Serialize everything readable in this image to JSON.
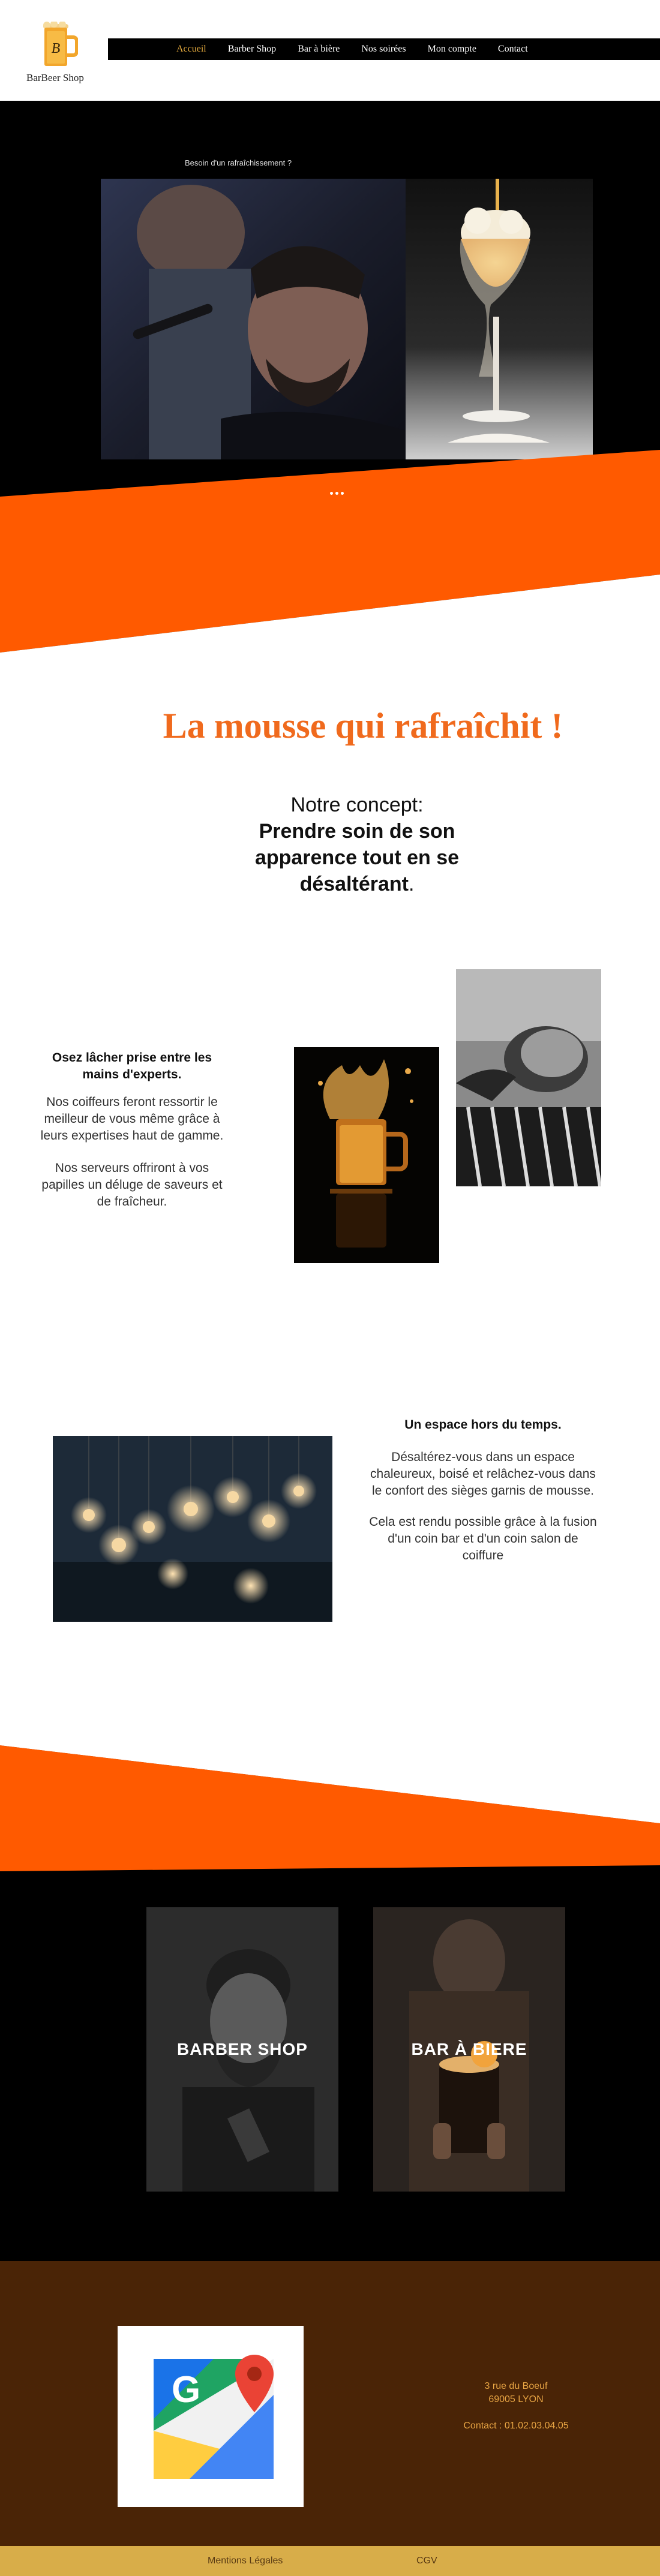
{
  "header": {
    "brand": "BarBeer Shop",
    "nav": [
      "Accueil",
      "Barber Shop",
      "Bar à bière",
      "Nos soirées",
      "Mon compte",
      "Contact"
    ],
    "active_index": 0
  },
  "hero": {
    "tagline": "Besoin d'un rafraîchissement ?",
    "image_left": "barber-trimming-client-photo",
    "image_right": "beer-glass-foam-photo",
    "slider_dots": 3
  },
  "intro": {
    "title": "La mousse qui rafraîchit !",
    "concept_lead": "Notre concept:",
    "concept_bold": "Prendre soin de son apparence tout en se désaltérant",
    "concept_tail": "."
  },
  "section_experts": {
    "heading": "Osez lâcher prise entre les mains d'experts.",
    "paragraph_1": "Nos coiffeurs feront ressortir le meilleur de vous même grâce à leurs expertises haut de gamme.",
    "paragraph_2": "Nos serveurs offriront à vos papilles un déluge de saveurs et de fraîcheur."
  },
  "section_space": {
    "heading": "Un espace hors du temps.",
    "paragraph_1": "Désaltérez-vous dans un espace chaleureux, boisé et relâchez-vous dans le confort des sièges garnis de mousse.",
    "paragraph_2": "Cela est rendu possible grâce à la fusion d'un coin bar et d'un coin salon de coiffure"
  },
  "services": {
    "barber_label": "BARBER SHOP",
    "bar_label": "BAR À BIERE"
  },
  "footer": {
    "address_line_1": "3 rue du Boeuf",
    "address_line_2": "69005 LYON",
    "contact": "Contact : 01.02.03.04.05",
    "legal_link": "Mentions Légales",
    "cgv_link": "CGV"
  },
  "colors": {
    "orange": "#ff5a00",
    "black": "#000000",
    "gold": "#e3a93d",
    "brown": "#4a2406",
    "legal_bar": "#d8ad49"
  }
}
